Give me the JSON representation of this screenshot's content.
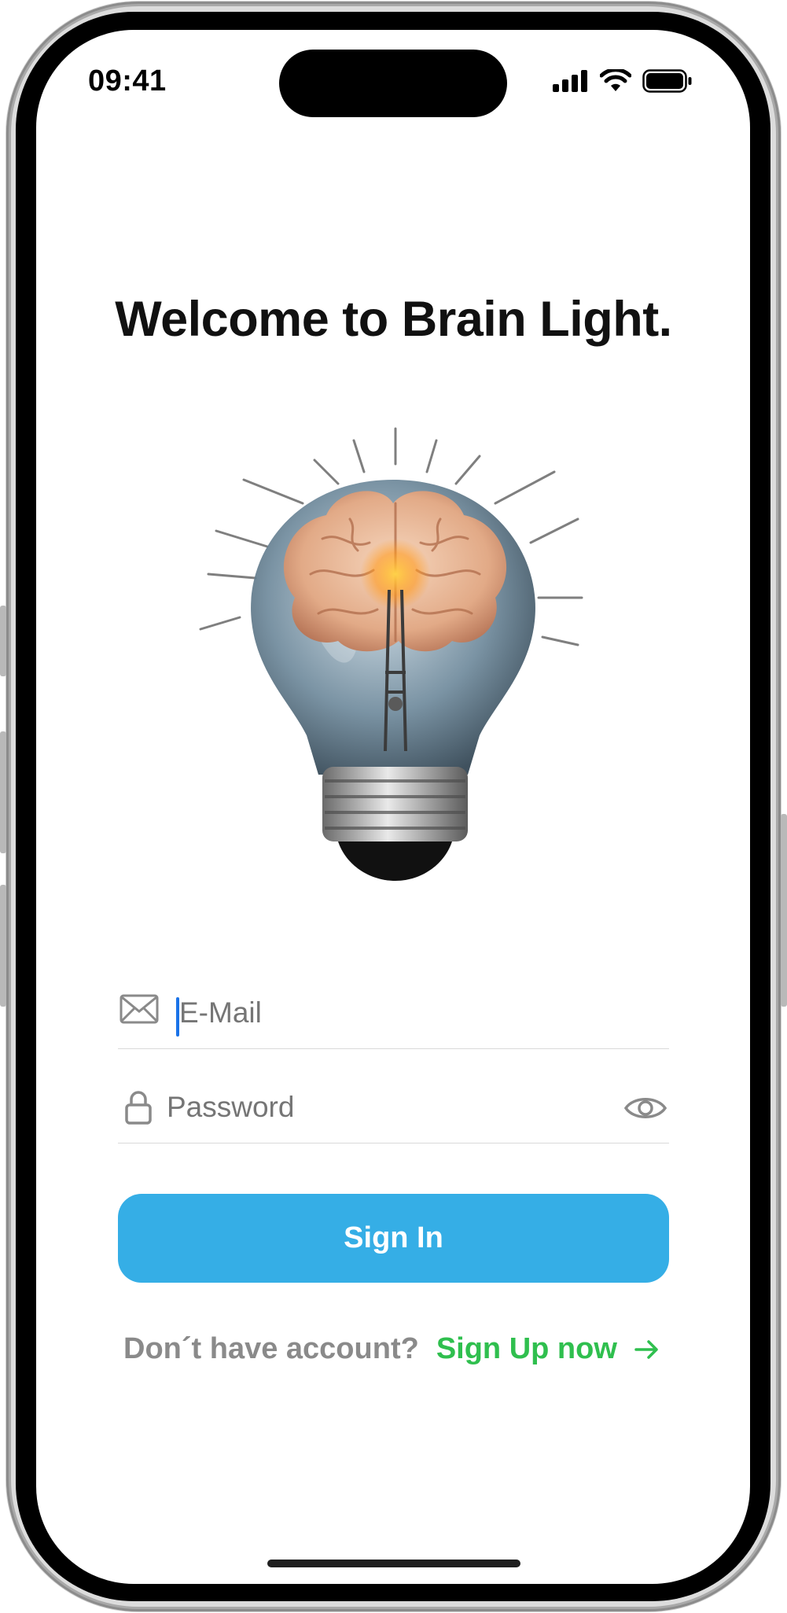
{
  "status_bar": {
    "time": "09:41"
  },
  "title": "Welcome to Brain Light.",
  "hero_image": {
    "icon": "brain-lightbulb-illustration"
  },
  "email": {
    "placeholder": "E-Mail",
    "value": "",
    "icon": "mail-icon"
  },
  "password": {
    "placeholder": "Password",
    "value": "",
    "icon": "lock-icon",
    "toggle_icon": "eye-icon"
  },
  "sign_in": {
    "label": "Sign In"
  },
  "signup_prompt": {
    "text": "Don´t have account?",
    "link": "Sign Up now",
    "arrow": "→"
  },
  "colors": {
    "primary": "#35aee6",
    "link": "#2fbf4e",
    "muted": "#8a8a8a"
  }
}
